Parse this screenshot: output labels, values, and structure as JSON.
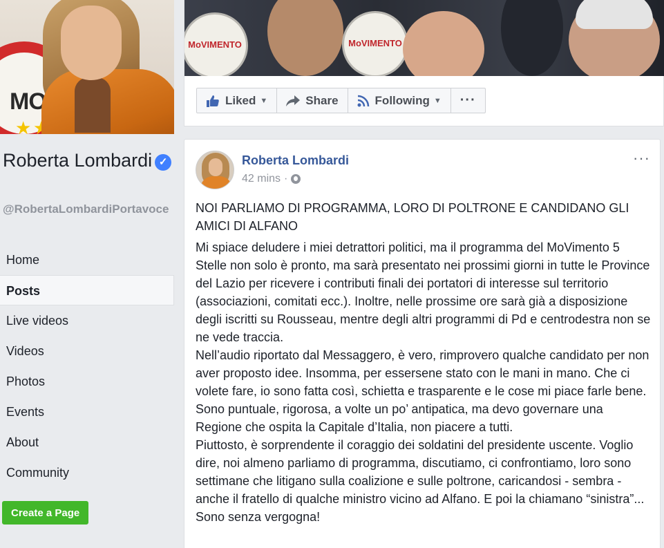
{
  "page": {
    "name": "Roberta Lombardi",
    "handle": "@RobertaLombardiPortavoce",
    "profile_picture_sign_text": "MOVI"
  },
  "cover": {
    "sign_text": "MoVIMENTO"
  },
  "actions": {
    "liked_label": "Liked",
    "share_label": "Share",
    "following_label": "Following",
    "more_label": "···"
  },
  "nav": {
    "items": [
      {
        "label": "Home"
      },
      {
        "label": "Posts",
        "active": true
      },
      {
        "label": "Live videos"
      },
      {
        "label": "Videos"
      },
      {
        "label": "Photos"
      },
      {
        "label": "Events"
      },
      {
        "label": "About"
      },
      {
        "label": "Community"
      }
    ],
    "create_page_label": "Create a Page"
  },
  "post": {
    "author": "Roberta Lombardi",
    "time": "42 mins",
    "separator": "·",
    "more": "···",
    "title": "NOI PARLIAMO DI PROGRAMMA, LORO DI POLTRONE E CANDIDANO GLI AMICI DI ALFANO",
    "paragraphs": [
      "Mi spiace deludere i miei detrattori politici, ma il programma del MoVimento 5 Stelle non solo è pronto, ma sarà presentato nei prossimi giorni in tutte le Province del Lazio per ricevere i contributi finali dei portatori di interesse sul territorio (associazioni, comitati ecc.). Inoltre, nelle prossime ore sarà già a disposizione degli iscritti su Rousseau, mentre degli altri programmi di Pd e centrodestra non se ne vede traccia.",
      "Nell’audio riportato dal Messaggero, è vero, rimprovero qualche candidato per non aver proposto idee. Insomma, per essersene stato con le mani in mano. Che ci volete fare, io sono fatta così, schietta e trasparente e le cose mi piace farle bene. Sono puntuale, rigorosa, a volte un po’ antipatica, ma devo governare una Regione che ospita la Capitale d’Italia, non piacere a tutti.",
      "Piuttosto, è sorprendente il coraggio dei soldatini del presidente uscente. Voglio dire, noi almeno parliamo di programma, discutiamo, ci confrontiamo, loro sono settimane che litigano sulla coalizione e sulle poltrone, caricandosi - sembra - anche il fratello di qualche ministro vicino ad Alfano. E poi la chiamano “sinistra”... Sono senza vergogna!"
    ]
  },
  "colors": {
    "background": "#e9ebee",
    "link_blue": "#365899",
    "verified_blue": "#4080ff",
    "create_green": "#42b72a"
  }
}
